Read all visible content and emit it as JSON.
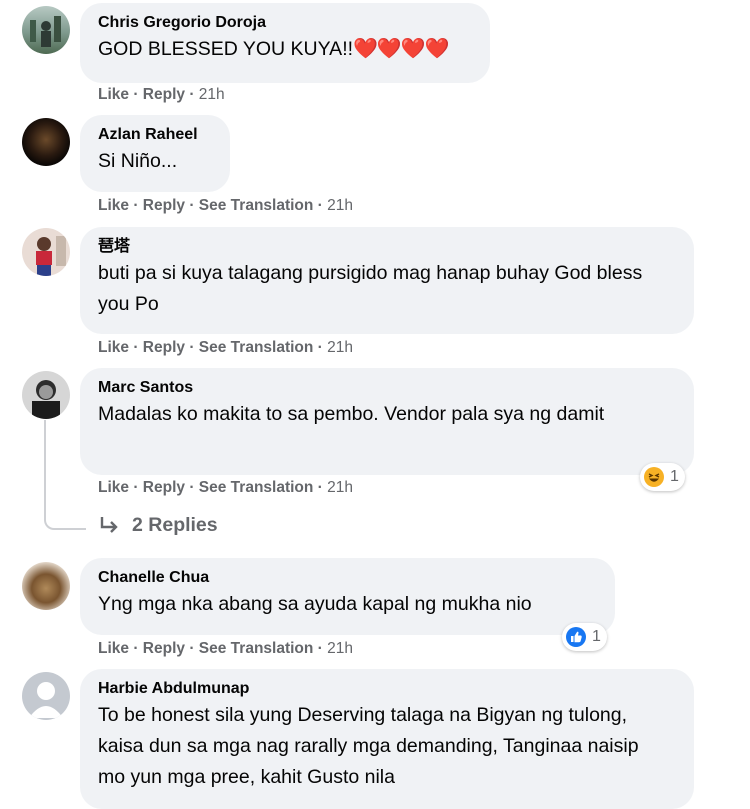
{
  "comments": [
    {
      "name": "Chris Gregorio Doroja",
      "text": "GOD BLESSED YOU KUYA!!",
      "hearts": "❤️❤️❤️❤️",
      "like": "Like",
      "reply": "Reply",
      "time": "21h"
    },
    {
      "name": "Azlan Raheel",
      "text": "Si Niño...",
      "like": "Like",
      "reply": "Reply",
      "translate": "See Translation",
      "time": "21h"
    },
    {
      "name": "琶塔",
      "text": "buti pa si kuya talagang pursigido mag hanap buhay God bless you Po",
      "like": "Like",
      "reply": "Reply",
      "translate": "See Translation",
      "time": "21h"
    },
    {
      "name": "Marc Santos",
      "text": "Madalas ko makita to sa pembo. Vendor pala sya ng damit",
      "like": "Like",
      "reply": "Reply",
      "translate": "See Translation",
      "time": "21h",
      "reaction_count": "1",
      "replies": "2 Replies"
    },
    {
      "name": "Chanelle Chua",
      "text": "Yng mga nka abang sa ayuda kapal ng mukha nio",
      "like": "Like",
      "reply": "Reply",
      "translate": "See Translation",
      "time": "21h",
      "reaction_count": "1"
    },
    {
      "name": "Harbie Abdulmunap",
      "text": "To be honest sila yung Deserving talaga na Bigyan ng tulong, kaisa dun sa mga nag rarally mga demanding, Tanginaa naisip mo yun mga pree, kahit Gusto nila"
    }
  ],
  "sep": " · ",
  "colors": {
    "bubble": "#f0f2f5",
    "meta": "#65676b",
    "like_blue": "#1877f2",
    "haha_yellow": "#f7b125",
    "heart_red": "#e41e3f"
  }
}
